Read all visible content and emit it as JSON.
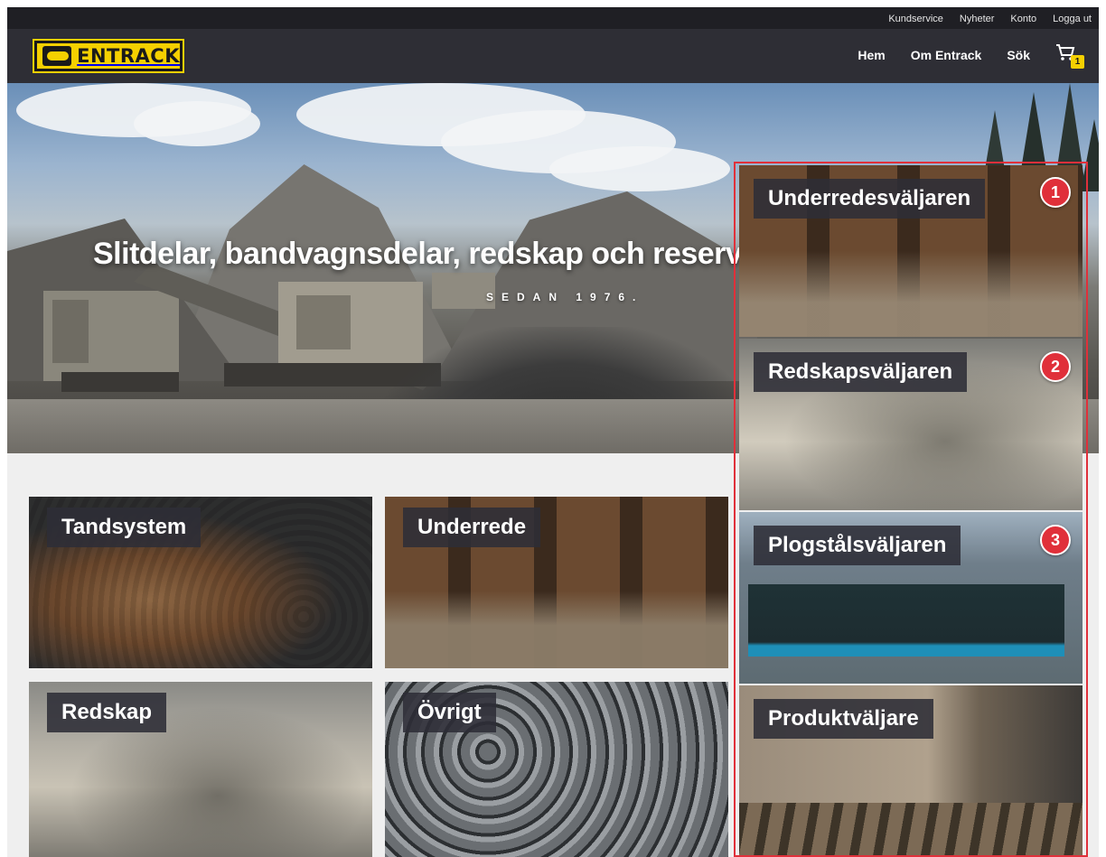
{
  "utility_nav": {
    "items": [
      "Kundservice",
      "Nyheter",
      "Konto",
      "Logga ut"
    ]
  },
  "header": {
    "logo_text": "ENTRACK",
    "menu": [
      "Hem",
      "Om Entrack",
      "Sök"
    ],
    "cart_count": "1"
  },
  "hero": {
    "title": "Slitdelar, bandvagnsdelar, redskap och reservdelar",
    "subtitle": "SEDAN 1976."
  },
  "categories": [
    {
      "label": "Tandsystem"
    },
    {
      "label": "Underrede"
    },
    {
      "label": "Redskap"
    },
    {
      "label": "Övrigt"
    }
  ],
  "selectors": [
    {
      "label": "Underredesväljaren",
      "badge": "1"
    },
    {
      "label": "Redskapsväljaren",
      "badge": "2"
    },
    {
      "label": "Plogstålsväljaren",
      "badge": "3"
    },
    {
      "label": "Produktväljare"
    }
  ],
  "colors": {
    "brand_yellow": "#f5d000",
    "nav_dark": "#2e2e35",
    "highlight_red": "#e0303a"
  }
}
